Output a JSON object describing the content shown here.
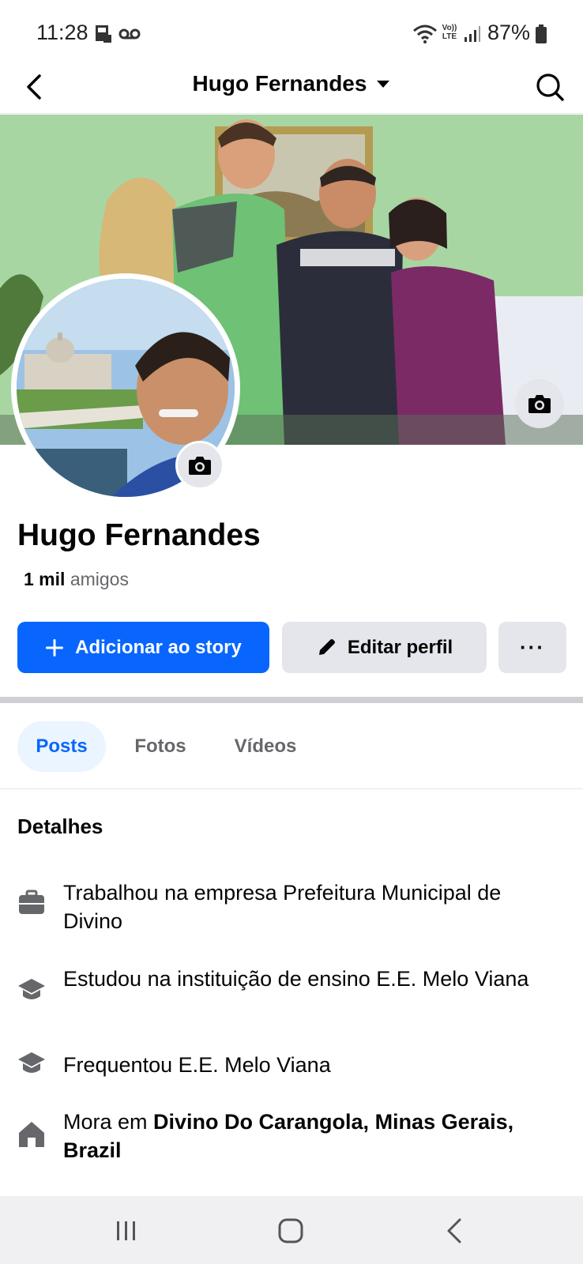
{
  "status_bar": {
    "time": "11:28",
    "battery": "87%",
    "volte_label": "Vo)) LTE"
  },
  "nav": {
    "title": "Hugo Fernandes"
  },
  "profile": {
    "name": "Hugo Fernandes",
    "friends_count": "1 mil",
    "friends_label": "amigos"
  },
  "actions": {
    "add_story": "Adicionar ao story",
    "edit_profile": "Editar perfil",
    "more": "···"
  },
  "tabs": [
    {
      "label": "Posts",
      "active": true
    },
    {
      "label": "Fotos",
      "active": false
    },
    {
      "label": "Vídeos",
      "active": false
    }
  ],
  "details": {
    "title": "Detalhes",
    "items": [
      {
        "icon": "briefcase-icon",
        "text": "Trabalhou na empresa Prefeitura Municipal de Divino"
      },
      {
        "icon": "graduation-cap-icon",
        "text": "Estudou na instituição de ensino E.E. Melo Viana"
      },
      {
        "icon": "graduation-cap-icon",
        "text": "Frequentou E.E. Melo Viana"
      },
      {
        "icon": "home-icon",
        "prefix": "Mora em ",
        "place": "Divino Do Carangola, Minas Gerais, Brazil"
      }
    ]
  },
  "colors": {
    "accent": "#0866ff",
    "button_gray": "#e4e6eb",
    "tab_active_bg": "#ebf5ff",
    "secondary_text": "#65676b"
  }
}
